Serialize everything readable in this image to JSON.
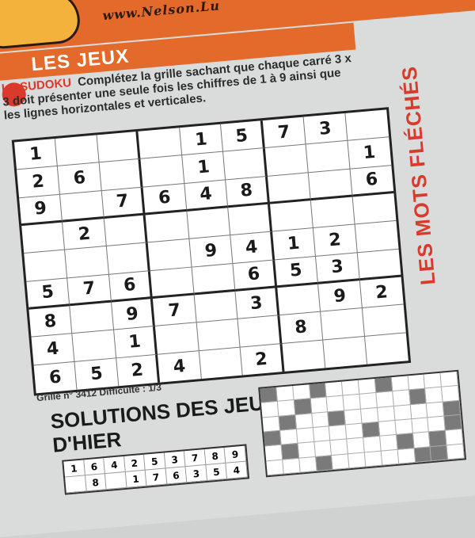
{
  "brand": {
    "site": "www.Nelson.Lu"
  },
  "section": {
    "title": "LES JEUX",
    "side_label": "LES MOTS FLÉCHÉS",
    "sudoku_label": "LE SUDOKU",
    "intro": "Complétez la grille sachant que chaque carré 3 x 3 doit présenter une seule fois les chiffres de 1 à 9 ainsi que les lignes horizontales et verticales."
  },
  "sudoku": {
    "grid": [
      [
        "1",
        "",
        "",
        "",
        "1",
        "5",
        "7",
        "3",
        ""
      ],
      [
        "2",
        "6",
        "",
        "",
        "1",
        "",
        "",
        "",
        "1"
      ],
      [
        "9",
        "",
        "7",
        "6",
        "4",
        "8",
        "",
        "",
        "6"
      ],
      [
        "",
        "2",
        "",
        "",
        "",
        "",
        "",
        "",
        ""
      ],
      [
        "",
        "",
        "",
        "",
        "9",
        "4",
        "1",
        "2",
        ""
      ],
      [
        "5",
        "7",
        "6",
        "",
        "",
        "6",
        "5",
        "3",
        ""
      ],
      [
        "8",
        "",
        "9",
        "7",
        "",
        "3",
        "",
        "9",
        "2"
      ],
      [
        "4",
        "",
        "1",
        "",
        "",
        "",
        "8",
        "",
        ""
      ],
      [
        "6",
        "5",
        "2",
        "4",
        "",
        "2",
        "",
        "",
        ""
      ]
    ],
    "footer": "Grille n° 3412  Difficulté : 1/3"
  },
  "solutions": {
    "title_line1": "SOLUTIONS DES JEUX",
    "title_line2": "D'HIER",
    "sudoku_grid_preview": [
      [
        "1",
        "6",
        "4",
        "2",
        "5",
        "3",
        "7",
        "8",
        "9"
      ],
      [
        "",
        "8",
        "",
        "1",
        "7",
        "6",
        "3",
        "5",
        "4"
      ]
    ]
  }
}
